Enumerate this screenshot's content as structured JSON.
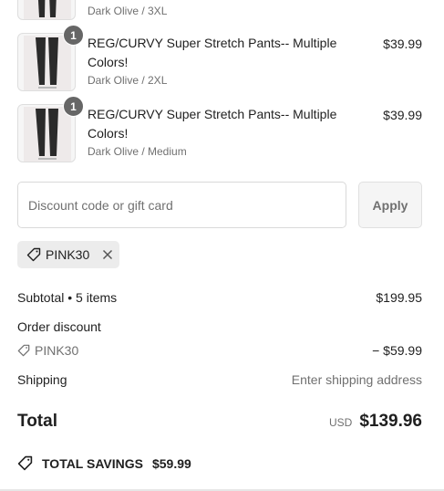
{
  "partial_item": {
    "variant": "Dark Olive / 3XL"
  },
  "items": [
    {
      "title": "REG/CURVY Super Stretch Pants-- Multiple Colors!",
      "variant": "Dark Olive / 2XL",
      "price": "$39.99",
      "quantity": "1"
    },
    {
      "title": "REG/CURVY Super Stretch Pants-- Multiple Colors!",
      "variant": "Dark Olive / Medium",
      "price": "$39.99",
      "quantity": "1"
    }
  ],
  "discount": {
    "placeholder": "Discount code or gift card",
    "value": "",
    "apply_label": "Apply",
    "applied_code": "PINK30"
  },
  "summary": {
    "subtotal_label": "Subtotal • 5 items",
    "subtotal_value": "$199.95",
    "order_discount_label": "Order discount",
    "order_discount_code": "PINK30",
    "order_discount_value": "− $59.99",
    "shipping_label": "Shipping",
    "shipping_value": "Enter shipping address",
    "total_label": "Total",
    "currency": "USD",
    "total_value": "$139.96",
    "savings_label": "TOTAL SAVINGS",
    "savings_value": "$59.99"
  },
  "colors": {
    "badge": "#666666",
    "muted_text": "#707070",
    "chip_bg": "#ececec"
  },
  "icons": {
    "tag": "tag-icon",
    "close": "close-icon"
  }
}
